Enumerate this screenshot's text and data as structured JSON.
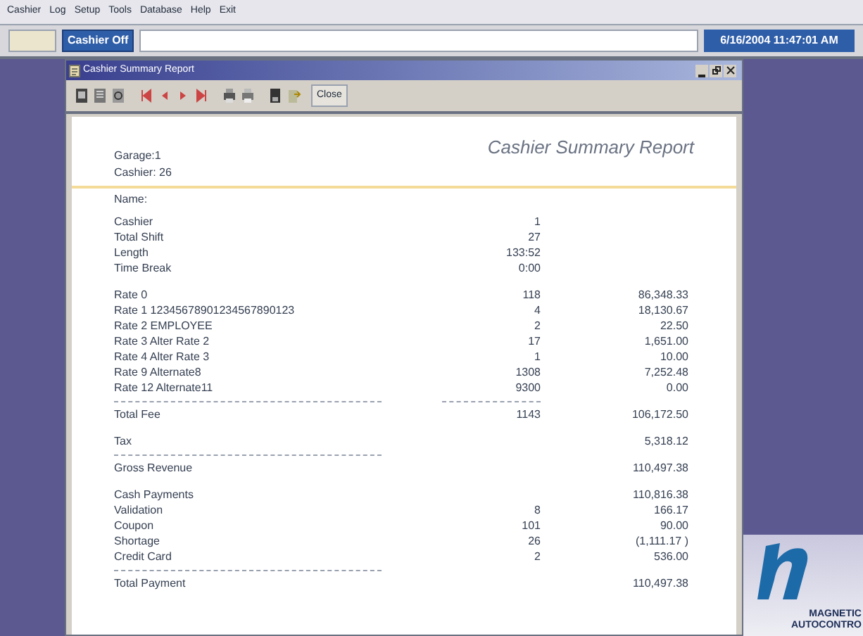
{
  "menu": [
    "Cashier",
    "Log",
    "Setup",
    "Tools",
    "Database",
    "Help",
    "Exit"
  ],
  "status": {
    "button": "Cashier Off",
    "datetime": "6/16/2004 11:47:01 AM"
  },
  "window": {
    "title": "Cashier Summary Report",
    "close_button": "Close"
  },
  "report": {
    "garage": "Garage:1",
    "cashier": "Cashier: 26",
    "title": "Cashier Summary Report",
    "name_label": "Name:",
    "rows": [
      {
        "kind": "row",
        "label": "Cashier",
        "count": "1"
      },
      {
        "kind": "row",
        "label": "Total Shift",
        "count": "27"
      },
      {
        "kind": "row",
        "label": "Length",
        "count": "133:52"
      },
      {
        "kind": "row",
        "label": "Time Break",
        "count": "0:00"
      },
      {
        "kind": "gap"
      },
      {
        "kind": "row",
        "label": "Rate 0",
        "count": "118",
        "amount": "86,348.33"
      },
      {
        "kind": "row",
        "label": "Rate 1 12345678901234567890123",
        "count": "4",
        "amount": "18,130.67"
      },
      {
        "kind": "row",
        "label": "Rate 2 EMPLOYEE",
        "count": "2",
        "amount": "22.50"
      },
      {
        "kind": "row",
        "label": "Rate 3 Alter Rate 2",
        "count": "17",
        "amount": "1,651.00"
      },
      {
        "kind": "row",
        "label": "Rate 4 Alter Rate 3",
        "count": "1",
        "amount": "10.00"
      },
      {
        "kind": "row",
        "label": "Rate 9 Alternate8",
        "count": "1308",
        "amount": "7,252.48"
      },
      {
        "kind": "row",
        "label": "Rate 12 Alternate11",
        "count": "9300",
        "amount": "0.00"
      },
      {
        "kind": "rule",
        "under_count": true
      },
      {
        "kind": "row",
        "label": "Total Fee",
        "count": "1143",
        "amount": "106,172.50"
      },
      {
        "kind": "gap"
      },
      {
        "kind": "row",
        "label": "Tax",
        "amount": "5,318.12"
      },
      {
        "kind": "rule",
        "under_count": false
      },
      {
        "kind": "row",
        "label": "Gross Revenue",
        "amount": "110,497.38"
      },
      {
        "kind": "gap"
      },
      {
        "kind": "row",
        "label": "Cash Payments",
        "amount": "110,816.38"
      },
      {
        "kind": "row",
        "label": "Validation",
        "count": "8",
        "amount": "166.17"
      },
      {
        "kind": "row",
        "label": "Coupon",
        "count": "101",
        "amount": "90.00"
      },
      {
        "kind": "row",
        "label": "Shortage",
        "count": "26",
        "amount": "(1,111.17 )"
      },
      {
        "kind": "row",
        "label": "Credit Card",
        "count": "2",
        "amount": "536.00"
      },
      {
        "kind": "rule",
        "under_count": false
      },
      {
        "kind": "row",
        "label": "Total Payment",
        "amount": "110,497.38"
      }
    ]
  },
  "logo": {
    "line_1": "MAGNETIC",
    "line_2": "AUTOCONTRO"
  }
}
